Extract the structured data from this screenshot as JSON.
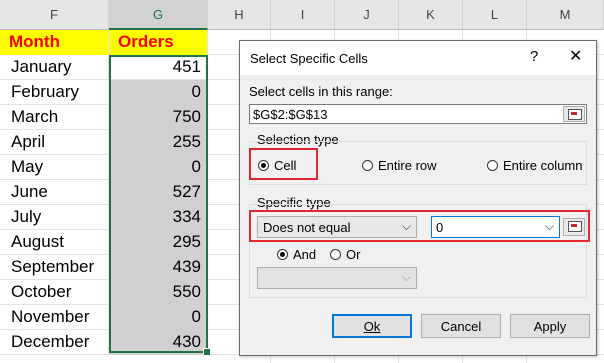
{
  "sheet": {
    "columns": [
      "F",
      "G",
      "H",
      "I",
      "J",
      "K",
      "L",
      "M"
    ],
    "header": {
      "month": "Month",
      "orders": "Orders"
    },
    "rows": [
      {
        "month": "January",
        "orders": "451"
      },
      {
        "month": "February",
        "orders": "0"
      },
      {
        "month": "March",
        "orders": "750"
      },
      {
        "month": "April",
        "orders": "255"
      },
      {
        "month": "May",
        "orders": "0"
      },
      {
        "month": "June",
        "orders": "527"
      },
      {
        "month": "July",
        "orders": "334"
      },
      {
        "month": "August",
        "orders": "295"
      },
      {
        "month": "September",
        "orders": "439"
      },
      {
        "month": "October",
        "orders": "550"
      },
      {
        "month": "November",
        "orders": "0"
      },
      {
        "month": "December",
        "orders": "430"
      }
    ],
    "colors": {
      "header_bg": "#ffff00",
      "header_text": "#ff0000",
      "selection": "#217346",
      "shade": "#d0d0d0"
    }
  },
  "dialog": {
    "title": "Select Specific Cells",
    "help": "?",
    "close": "✕",
    "range_label": "Select cells in this range:",
    "range_value": "$G$2:$G$13",
    "selection_type_label": "Selection type",
    "sel_cell": "Cell",
    "sel_row": "Entire row",
    "sel_column": "Entire column",
    "specific_type_label": "Specific type",
    "condition1": "Does not equal",
    "value1": "0",
    "and_label": "And",
    "or_label": "Or",
    "condition2": "",
    "ok": "Ok",
    "cancel": "Cancel",
    "apply": "Apply",
    "highlight_color": "#e0282e"
  }
}
